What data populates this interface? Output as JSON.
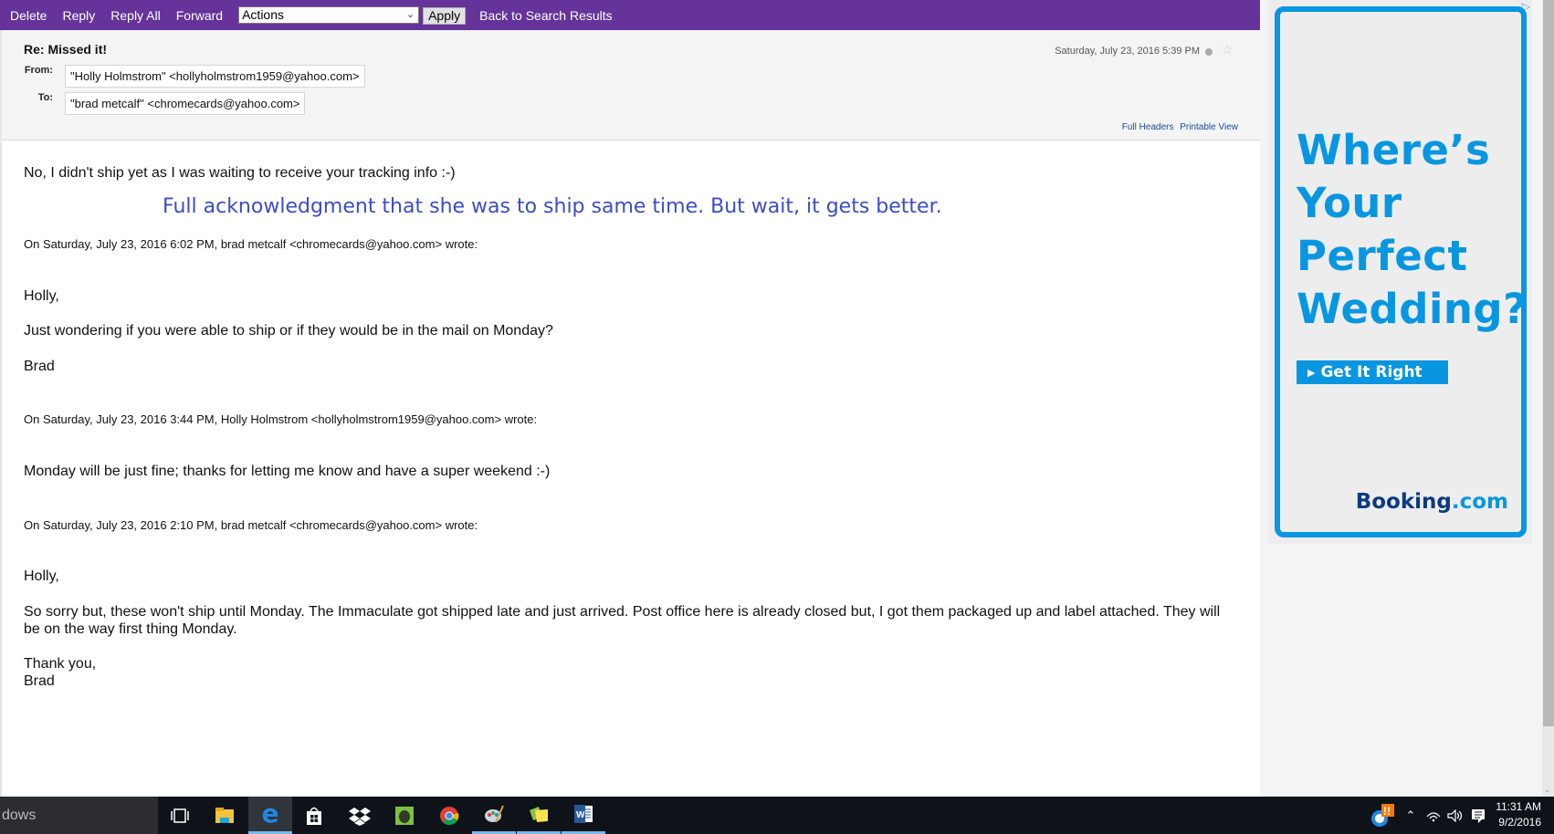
{
  "toolbar": {
    "delete": "Delete",
    "reply": "Reply",
    "reply_all": "Reply All",
    "forward": "Forward",
    "actions_select": "Actions",
    "apply": "Apply",
    "back": "Back to Search Results",
    "accent_color": "#653399"
  },
  "message": {
    "subject": "Re: Missed it!",
    "from_label": "From:",
    "from_value": "\"Holly Holmstrom\" <hollyholmstrom1959@yahoo.com>",
    "to_label": "To:",
    "to_value": "\"brad metcalf\" <chromecards@yahoo.com>",
    "date": "Saturday, July 23, 2016 5:39 PM",
    "full_headers": "Full Headers",
    "printable_view": "Printable View"
  },
  "body": {
    "reply_line": "No, I didn't ship yet as I was waiting to receive your tracking info :-)",
    "annotation": "Full acknowledgment that she was to ship same time. But wait, it gets better.",
    "quote1_header": "On Saturday, July 23, 2016 6:02 PM, brad metcalf <chromecards@yahoo.com> wrote:",
    "quote1_greeting": "Holly,",
    "quote1_line": "Just wondering if you were able to ship or if they would be in the mail on Monday?",
    "quote1_sign": "Brad",
    "quote2_header": "On Saturday, July 23, 2016 3:44 PM, Holly Holmstrom <hollyholmstrom1959@yahoo.com> wrote:",
    "quote2_line": "Monday will be just fine; thanks for letting me know and have a super weekend :-)",
    "quote3_header": "On Saturday, July 23, 2016 2:10 PM, brad metcalf <chromecards@yahoo.com> wrote:",
    "quote3_greeting": "Holly,",
    "quote3_line1": "So sorry but, these won't ship until Monday. The Immaculate got shipped late and just arrived. Post office here is already closed but, I got them packaged up and label attached. They will",
    "quote3_line2": "be on the way first thing Monday.",
    "quote3_thanks": "Thank you,",
    "quote3_sign": "Brad"
  },
  "ad": {
    "headline": [
      "Where’s",
      "Your",
      "Perfect",
      "Wedding?"
    ],
    "cta": "Get It Right",
    "brand_main": "Booking",
    "brand_suffix": ".com",
    "adchoices_icon": "▷",
    "color": "#0896e0"
  },
  "taskbar": {
    "search_text": "dows",
    "icons": [
      {
        "name": "task-view-icon",
        "glyph": "[☐]"
      },
      {
        "name": "file-explorer-icon",
        "glyph": ""
      },
      {
        "name": "edge-icon",
        "glyph": "e"
      },
      {
        "name": "store-icon",
        "glyph": ""
      },
      {
        "name": "dropbox-icon",
        "glyph": ""
      },
      {
        "name": "evernote-icon",
        "glyph": ""
      },
      {
        "name": "chrome-icon",
        "glyph": ""
      },
      {
        "name": "paint-icon",
        "glyph": ""
      },
      {
        "name": "sticky-notes-icon",
        "glyph": ""
      },
      {
        "name": "word-icon",
        "glyph": "W"
      }
    ],
    "time": "11:31 AM",
    "date": "9/2/2016"
  }
}
